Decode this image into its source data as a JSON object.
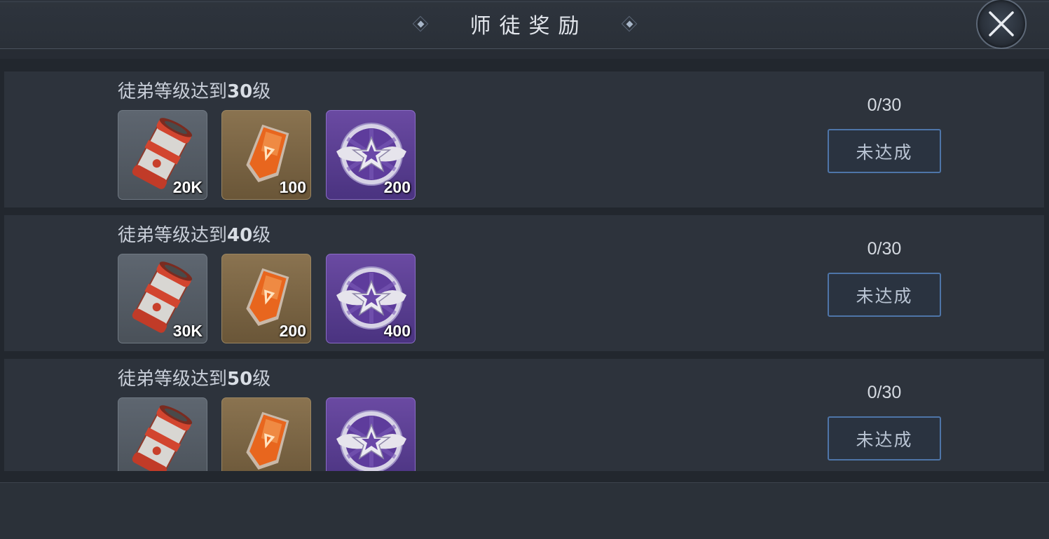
{
  "header": {
    "title": "师徒奖励",
    "left_ornament": "diamond-ornament-icon",
    "right_ornament": "diamond-ornament-icon",
    "close_icon": "close-icon"
  },
  "rows": [
    {
      "label_prefix": "徒弟等级达到",
      "level": "30",
      "label_suffix": "级",
      "rewards": [
        {
          "icon": "fuel-barrel-icon",
          "count": "20K"
        },
        {
          "icon": "orange-badge-icon",
          "count": "100"
        },
        {
          "icon": "purple-winged-star-medal-icon",
          "count": "200"
        }
      ],
      "progress": "0/30",
      "status": "未达成"
    },
    {
      "label_prefix": "徒弟等级达到",
      "level": "40",
      "label_suffix": "级",
      "rewards": [
        {
          "icon": "fuel-barrel-icon",
          "count": "30K"
        },
        {
          "icon": "orange-badge-icon",
          "count": "200"
        },
        {
          "icon": "purple-winged-star-medal-icon",
          "count": "400"
        }
      ],
      "progress": "0/30",
      "status": "未达成"
    },
    {
      "label_prefix": "徒弟等级达到",
      "level": "50",
      "label_suffix": "级",
      "rewards": [
        {
          "icon": "fuel-barrel-icon",
          "count": ""
        },
        {
          "icon": "orange-badge-icon",
          "count": ""
        },
        {
          "icon": "purple-winged-star-medal-icon",
          "count": ""
        }
      ],
      "progress": "0/30",
      "status": "未达成"
    }
  ],
  "colors": {
    "background": "#272c34",
    "row_background": "#2d333c",
    "button_border": "#4e75a8",
    "purple_item": "#5a3d92",
    "gold_item": "#7a6444",
    "gray_item": "#555d66"
  }
}
